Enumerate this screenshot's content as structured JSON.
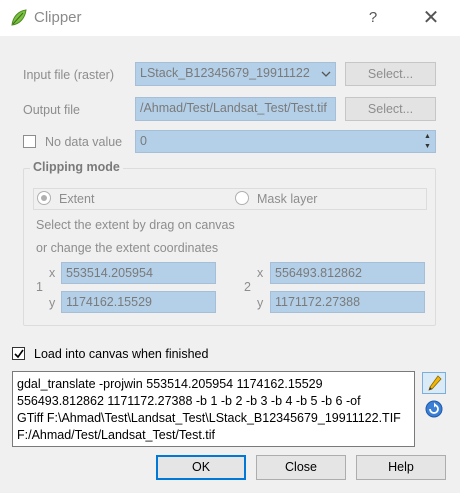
{
  "window": {
    "title": "Clipper",
    "help_glyph": "?",
    "close_glyph": "✕"
  },
  "input": {
    "label": "Input file (raster)",
    "value": "LStack_B12345679_19911122",
    "select_label": "Select..."
  },
  "output": {
    "label": "Output file",
    "value": "/Ahmad/Test/Landsat_Test/Test.tif",
    "select_label": "Select..."
  },
  "nodata": {
    "label": "No data value",
    "checked": false,
    "value": "0"
  },
  "clipping": {
    "title": "Clipping mode",
    "extent_label": "Extent",
    "mask_label": "Mask layer",
    "hint_line1": "Select the extent by drag on canvas",
    "hint_line2": "or change the extent coordinates",
    "point1": {
      "index": "1",
      "x_label": "x",
      "y_label": "y",
      "x": "553514.205954",
      "y": "1174162.15529"
    },
    "point2": {
      "index": "2",
      "x_label": "x",
      "y_label": "y",
      "x": "556493.812862",
      "y": "1171172.27388"
    }
  },
  "load": {
    "label": "Load into canvas when finished",
    "checked": true
  },
  "command": {
    "line1": "gdal_translate -projwin 553514.205954 1174162.15529",
    "line2": "556493.812862 1171172.27388 -b 1 -b 2 -b 3 -b 4 -b 5 -b 6 -of",
    "line3": "GTiff F:\\Ahmad\\Test\\Landsat_Test\\LStack_B12345679_19911122.TIF",
    "line4": "F:/Ahmad/Test/Landsat_Test/Test.tif"
  },
  "buttons": {
    "ok": "OK",
    "close": "Close",
    "help": "Help"
  },
  "colors": {
    "field_bg": "#b4d0e8",
    "accent": "#0078d7"
  }
}
